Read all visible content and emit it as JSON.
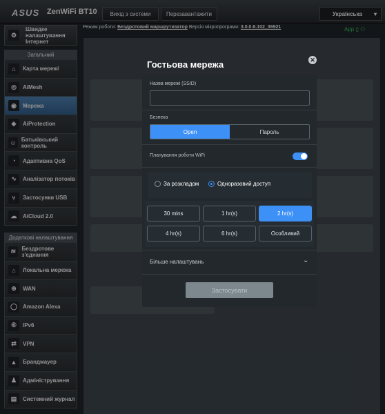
{
  "header": {
    "logo": "ASUS",
    "model": "ZenWiFi BT10",
    "logout_label": "Вихід з системи",
    "reboot_label": "Перезавантажити",
    "language": "Українська"
  },
  "status": {
    "mode_label": "Режим роботи:",
    "mode_value": "Бездротовий маршрутизатор",
    "fw_label": "Версія мікропрограми:",
    "fw_value": "3.0.0.6.102_36921",
    "app_label": "App"
  },
  "sidebar": {
    "quick_setup": "Швидке налаштування Інтернет",
    "general_header": "Загальний",
    "general_items": [
      {
        "label": "Карта мережі",
        "icon": "network-map-icon"
      },
      {
        "label": "AiMesh",
        "icon": "aimesh-icon"
      },
      {
        "label": "Мережа",
        "icon": "network-icon"
      },
      {
        "label": "AiProtection",
        "icon": "shield-icon"
      },
      {
        "label": "Батьківський контроль",
        "icon": "parental-control-icon"
      },
      {
        "label": "Адаптивна QoS",
        "icon": "qos-icon"
      },
      {
        "label": "Аналізатор потоків",
        "icon": "traffic-analyzer-icon"
      },
      {
        "label": "Застосунки USB",
        "icon": "usb-icon"
      },
      {
        "label": "AiCloud 2.0",
        "icon": "cloud-icon"
      }
    ],
    "advanced_header": "Додаткові налаштування",
    "advanced_items": [
      {
        "label": "Бездротове з'єднання",
        "icon": "wireless-icon"
      },
      {
        "label": "Локальна мережа",
        "icon": "lan-icon"
      },
      {
        "label": "WAN",
        "icon": "wan-icon"
      },
      {
        "label": "Amazon Alexa",
        "icon": "alexa-icon"
      },
      {
        "label": "IPv6",
        "icon": "ipv6-icon"
      },
      {
        "label": "VPN",
        "icon": "vpn-icon"
      },
      {
        "label": "Брандмауер",
        "icon": "firewall-icon"
      },
      {
        "label": "Адміністрування",
        "icon": "admin-icon"
      },
      {
        "label": "Системний журнал",
        "icon": "syslog-icon"
      }
    ]
  },
  "modal": {
    "title": "Гостьова мережа",
    "ssid_label": "Назва мережі (SSID)",
    "ssid_value": "",
    "security_label": "Безпека",
    "security_options": [
      "Open",
      "Пароль"
    ],
    "security_selected": "Open",
    "wifi_schedule_label": "Планування роботи WiFi",
    "wifi_schedule_enabled": true,
    "schedule_options": [
      "За розкладом",
      "Одноразовий доступ"
    ],
    "schedule_selected": "Одноразовий доступ",
    "durations": [
      "30 mins",
      "1 hr(s)",
      "2 hr(s)",
      "4 hr(s)",
      "6 hr(s)",
      "Особливий"
    ],
    "duration_selected": "2 hr(s)",
    "more_settings": "Більше налаштувань",
    "apply_label": "Застосувати"
  },
  "colors": {
    "accent": "#3d90f5",
    "active_nav": "#3f74a8"
  }
}
